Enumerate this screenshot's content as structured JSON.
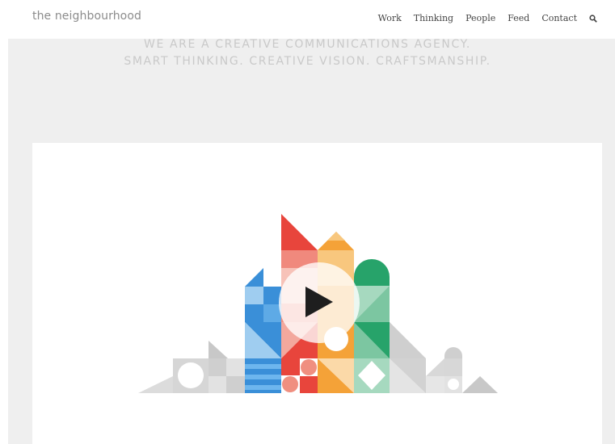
{
  "header": {
    "logo": "the neighbourhood",
    "nav": [
      {
        "label": "Work"
      },
      {
        "label": "Thinking"
      },
      {
        "label": "People"
      },
      {
        "label": "Feed"
      },
      {
        "label": "Contact"
      }
    ],
    "search_icon": "search-icon"
  },
  "hero": {
    "line1": "WE ARE A CREATIVE COMMUNICATIONS AGENCY.",
    "line2": "SMART THINKING. CREATIVE VISION. CRAFTSMANSHIP."
  },
  "video": {
    "play_icon": "play-icon"
  },
  "colors": {
    "background": "#efefef",
    "tagline": "#c9c9c9",
    "red": "#e8453c",
    "orange": "#f4a238",
    "blue": "#3a8fd8",
    "green": "#27a36a",
    "grey": "#cfcfcf"
  }
}
